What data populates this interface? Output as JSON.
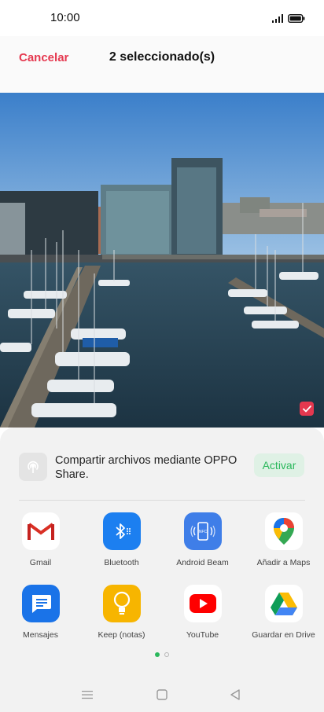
{
  "status_bar": {
    "time": "10:00",
    "icons": [
      "signal-icon",
      "battery-icon"
    ]
  },
  "header": {
    "cancel_label": "Cancelar",
    "title": "2 seleccionado(s)"
  },
  "colors": {
    "accent": "#e5384f",
    "green": "#2bb85c",
    "sheet_bg": "#f2f2f2"
  },
  "photo": {
    "selected": true
  },
  "oppo_share": {
    "text": "Compartir archivos mediante OPPO Share.",
    "button": "Activar"
  },
  "apps": [
    {
      "label": "Gmail",
      "icon": "gmail-icon"
    },
    {
      "label": "Bluetooth",
      "icon": "bluetooth-icon"
    },
    {
      "label": "Android Beam",
      "icon": "nfc-icon"
    },
    {
      "label": "Añadir a Maps",
      "icon": "maps-icon"
    },
    {
      "label": "Mensajes",
      "icon": "messages-icon"
    },
    {
      "label": "Keep (notas)",
      "icon": "keep-icon"
    },
    {
      "label": "YouTube",
      "icon": "youtube-icon"
    },
    {
      "label": "Guardar en Drive",
      "icon": "drive-icon"
    }
  ],
  "pager": {
    "pages": 2,
    "current": 1
  },
  "nav": [
    "menu-icon",
    "home-icon",
    "back-icon"
  ]
}
